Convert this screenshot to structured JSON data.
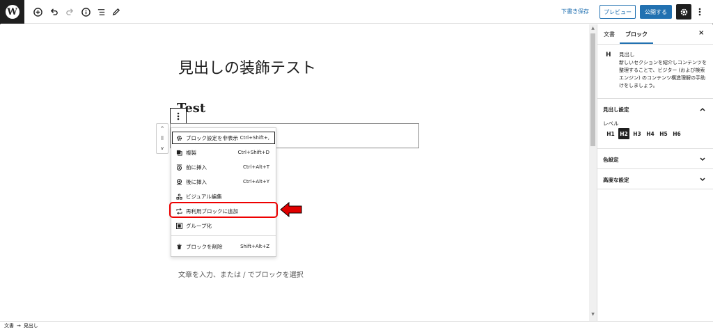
{
  "toolbar": {
    "logo_letter": "W",
    "save_draft": "下書き保存",
    "preview": "プレビュー",
    "publish": "公開する",
    "icons": [
      "plus-circle-icon",
      "undo-icon",
      "redo-icon",
      "info-icon",
      "list-view-icon",
      "pencil-icon",
      "gear-icon",
      "more-vertical-icon"
    ]
  },
  "editor": {
    "post_title": "見出しの装飾テスト",
    "heading_text": "Test",
    "paragraph_placeholder": "文章を入力、または / でブロックを選択",
    "mover_up": "^",
    "mover_handle": "⠿",
    "mover_down": "v"
  },
  "menu": {
    "items": [
      {
        "label": "ブロック設定を非表示",
        "shortcut": "Ctrl+Shift+,",
        "icon": "gear-icon"
      },
      {
        "label": "複製",
        "shortcut": "Ctrl+Shift+D",
        "icon": "duplicate-icon"
      },
      {
        "label": "前に挿入",
        "shortcut": "Ctrl+Alt+T",
        "icon": "insert-before-icon"
      },
      {
        "label": "後に挿入",
        "shortcut": "Ctrl+Alt+Y",
        "icon": "insert-after-icon"
      },
      {
        "label": "ビジュアル編集",
        "shortcut": "",
        "icon": "visual-edit-icon"
      },
      {
        "label": "再利用ブロックに追加",
        "shortcut": "",
        "icon": "reusable-block-icon"
      },
      {
        "label": "グループ化",
        "shortcut": "",
        "icon": "group-icon"
      },
      {
        "label": "ブロックを削除",
        "shortcut": "Shift+Alt+Z",
        "icon": "trash-icon"
      }
    ],
    "highlight_color": "#e00000"
  },
  "sidebar": {
    "tabs": [
      {
        "label": "文書",
        "active": false
      },
      {
        "label": "ブロック",
        "active": true
      }
    ],
    "close": "×",
    "block_card": {
      "icon_letter": "H",
      "title": "見出し",
      "description": "新しいセクションを紹介しコンテンツを整理することで、ビジター (および検索エンジン) のコンテンツ構造理解の手助けをしましょう。"
    },
    "panels": {
      "heading_settings": {
        "title": "見出し設定",
        "expanded": true
      },
      "level_label": "レベル",
      "levels": [
        "H1",
        "H2",
        "H3",
        "H4",
        "H5",
        "H6"
      ],
      "selected_level": "H2",
      "color_settings": {
        "title": "色設定",
        "expanded": false
      },
      "advanced": {
        "title": "高度な設定",
        "expanded": false
      }
    }
  },
  "breadcrumb": {
    "items": [
      "文書",
      "見出し"
    ],
    "separator": "→"
  },
  "colors": {
    "accent": "#2271b1",
    "dark": "#1e1e1e",
    "arrow_red": "#e00000"
  }
}
